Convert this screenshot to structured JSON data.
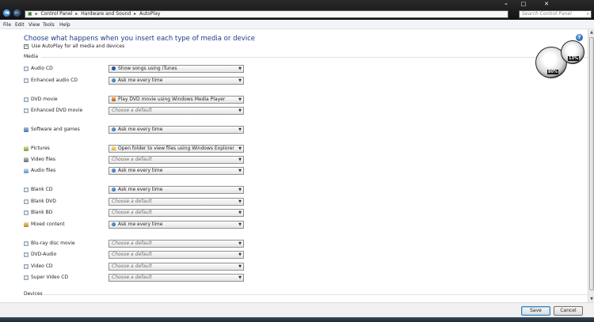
{
  "window": {
    "caption_buttons": [
      "–",
      "□",
      "✕"
    ]
  },
  "address_bar": {
    "crumbs": [
      "Control Panel",
      "Hardware and Sound",
      "AutoPlay"
    ],
    "separator": "▸"
  },
  "search": {
    "placeholder": "Search Control Panel"
  },
  "menu": [
    "File",
    "Edit",
    "View",
    "Tools",
    "Help"
  ],
  "page": {
    "title": "Choose what happens when you insert each type of media or device",
    "use_autoplay_label": "Use AutoPlay for all media and devices",
    "use_autoplay_checked": true,
    "media_section": "Media",
    "devices_section": "Devices"
  },
  "media_rows": [
    {
      "label": "Audio CD",
      "icon": "disc-icon",
      "value": "Show songs using iTunes",
      "value_icon": "itunes-icon"
    },
    {
      "label": "Enhanced audio CD",
      "icon": "disc-icon",
      "value": "Ask me every time",
      "value_icon": "ask-icon"
    },
    {
      "label": "DVD movie",
      "icon": "disc-icon",
      "value": "Play DVD movie using Windows Media Player",
      "value_icon": "wmp-icon"
    },
    {
      "label": "Enhanced DVD movie",
      "icon": "disc-icon",
      "value": "Choose a default",
      "value_icon": ""
    },
    {
      "label": "Software and games",
      "icon": "software-icon",
      "value": "Ask me every time",
      "value_icon": "ask-icon"
    },
    {
      "label": "Pictures",
      "icon": "pictures-icon",
      "value": "Open folder to view files using Windows Explorer",
      "value_icon": "folder-icon"
    },
    {
      "label": "Video files",
      "icon": "video-icon",
      "value": "Choose a default",
      "value_icon": ""
    },
    {
      "label": "Audio files",
      "icon": "audio-icon",
      "value": "Ask me every time",
      "value_icon": "ask-icon"
    },
    {
      "label": "Blank CD",
      "icon": "disc-icon",
      "value": "Ask me every time",
      "value_icon": "ask-icon"
    },
    {
      "label": "Blank DVD",
      "icon": "disc-icon",
      "value": "Choose a default",
      "value_icon": ""
    },
    {
      "label": "Blank BD",
      "icon": "disc-icon",
      "value": "Choose a default",
      "value_icon": ""
    },
    {
      "label": "Mixed content",
      "icon": "mixed-icon",
      "value": "Ask me every time",
      "value_icon": "ask-icon"
    },
    {
      "label": "Blu-ray disc movie",
      "icon": "disc-icon",
      "value": "Choose a default",
      "value_icon": ""
    },
    {
      "label": "DVD-Audio",
      "icon": "disc-icon",
      "value": "Choose a default",
      "value_icon": ""
    },
    {
      "label": "Video CD",
      "icon": "disc-icon",
      "value": "Choose a default",
      "value_icon": ""
    },
    {
      "label": "Super Video CD",
      "icon": "disc-icon",
      "value": "Choose a default",
      "value_icon": ""
    }
  ],
  "footer": {
    "save_label": "Save",
    "cancel_label": "Cancel"
  },
  "gadget": {
    "readout_left": "80%",
    "readout_right": "13%"
  }
}
